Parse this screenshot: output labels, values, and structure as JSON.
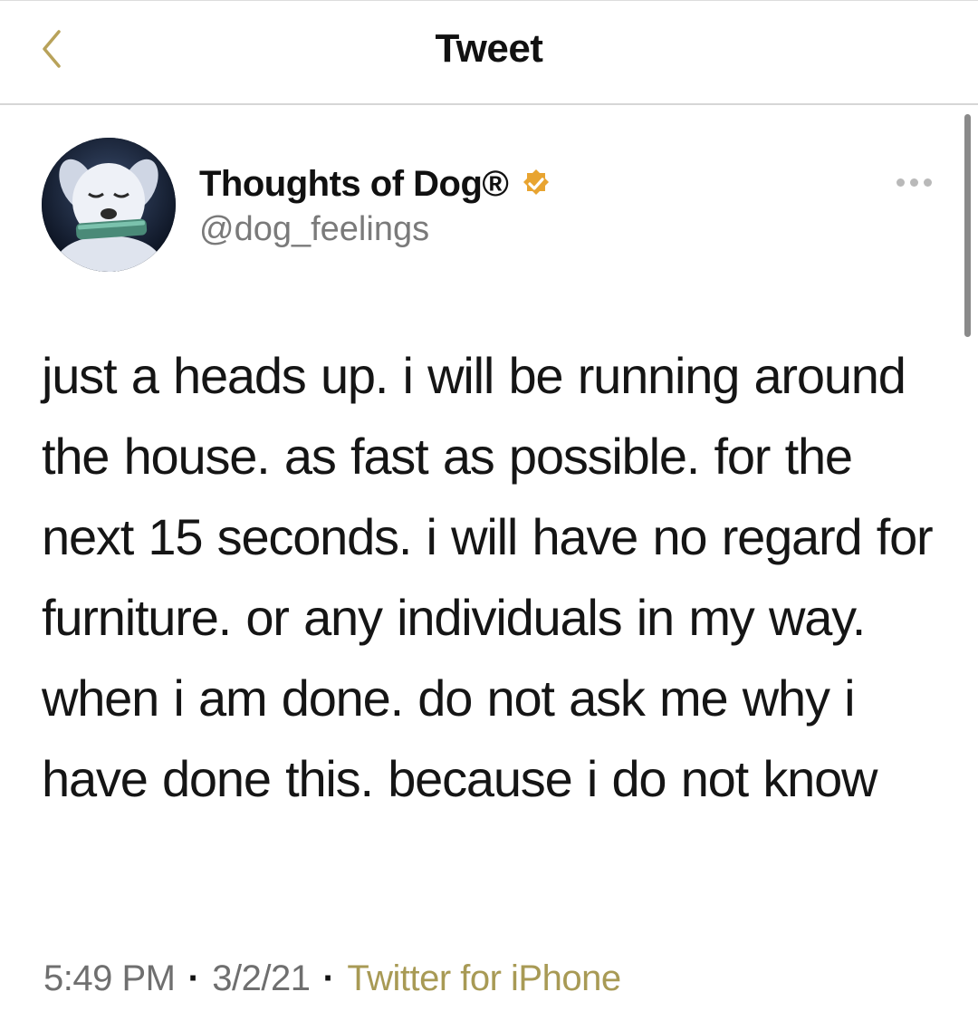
{
  "header": {
    "back_label": "<",
    "title": "Tweet"
  },
  "profile": {
    "name": "Thoughts of Dog®",
    "handle": "@dog_feelings",
    "verified": true,
    "avatar_icon": "dog-avatar"
  },
  "tweet": {
    "text": "just a heads up. i will be running around the house. as fast as possible. for the next 15 seconds. i will have no regard for furniture. or any individuals in my way. when i am done. do not ask me why i have done this. because i do not know"
  },
  "meta": {
    "time": "5:49 PM",
    "date": "3/2/21",
    "separator": "·",
    "source": "Twitter for iPhone"
  },
  "colors": {
    "accent_source": "#a89a55",
    "verified": "#e8a431",
    "secondary_text": "#7a7a7a"
  }
}
